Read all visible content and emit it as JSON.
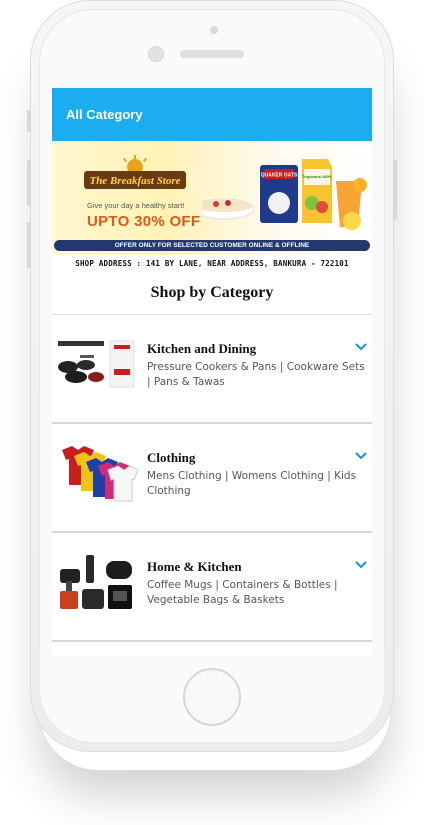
{
  "appbar": {
    "title": "All Category"
  },
  "banner": {
    "logo_text": "The Breakfast Store",
    "tagline": "Give your day a healthy start!",
    "offer": "UPTO 30% OFF",
    "strip": "OFFER ONLY FOR SELECTED CUSTOMER ONLINE & OFFLINE",
    "products": [
      "QUAKER OATS",
      "Tropicana 100%"
    ]
  },
  "shop_address": "SHOP ADDRESS : 141 BY LANE, NEAR ADDRESS, BANKURA - 722101",
  "section_title": "Shop by Category",
  "categories": [
    {
      "name": "Kitchen and Dining",
      "description": "Pressure Cookers & Pans | Cookware Sets | Pans & Tawas",
      "image": "cookware-set"
    },
    {
      "name": "Clothing",
      "description": "Mens Clothing | Womens Clothing | Kids Clothing",
      "image": "polo-shirts"
    },
    {
      "name": "Home & Kitchen",
      "description": "Coffee Mugs | Containers & Bottles | Vegetable Bags & Baskets",
      "image": "kitchen-appliances"
    }
  ],
  "colors": {
    "appbar": "#1badf0",
    "chevron": "#1a8fd6"
  }
}
